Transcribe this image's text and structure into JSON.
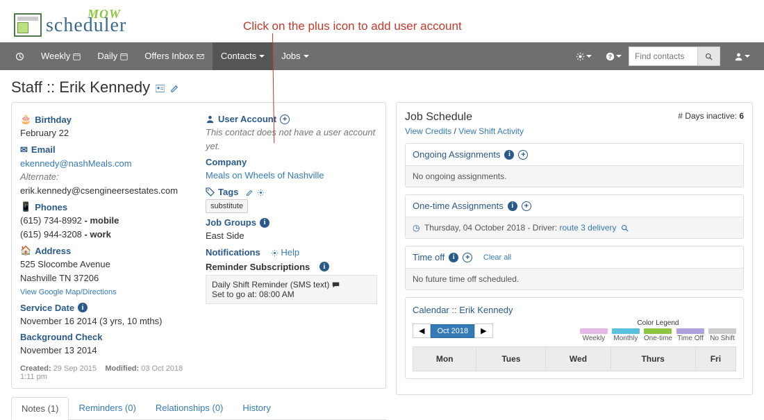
{
  "annotation": "Click on the plus icon to add user account",
  "nav": {
    "weekly": "Weekly",
    "daily": "Daily",
    "offers": "Offers Inbox",
    "contacts": "Contacts",
    "jobs": "Jobs",
    "search_placeholder": "Find contacts"
  },
  "page_title": "Staff :: Erik Kennedy",
  "contact": {
    "birthday_label": "Birthday",
    "birthday_value": "February 22",
    "email_label": "Email",
    "email_primary": "ekennedy@nashMeals.com",
    "email_alt_label": "Alternate:",
    "email_alt": "erik.kennedy@csengineersestates.com",
    "phones_label": "Phones",
    "phone1_num": "(615) 734-8992",
    "phone1_type": " - mobile",
    "phone2_num": "(615) 944-3208",
    "phone2_type": " - work",
    "address_label": "Address",
    "address_line1": "525 Slocombe Avenue",
    "address_line2": "Nashville TN 37206",
    "map_link": "View Google Map/Directions",
    "service_label": "Service Date",
    "service_value": "November 16 2014 (3 yrs, 10 mths)",
    "bg_label": "Background Check",
    "bg_value": "November 13 2014",
    "created_label": "Created:",
    "created_value": "29 Sep 2015",
    "modified_label": "Modified:",
    "modified_value": "03 Oct 2018 1:11 pm"
  },
  "account": {
    "ua_label": "User Account",
    "ua_msg": "This contact does not have a user account yet.",
    "company_label": "Company",
    "company_value": "Meals on Wheels of Nashville",
    "tags_label": "Tags",
    "tag1": "substitute",
    "jg_label": "Job Groups",
    "jg_value": "East Side",
    "notif_label": "Notifications",
    "notif_help": "Help",
    "rs_label": "Reminder Subscriptions",
    "rs_line1": "Daily Shift Reminder (SMS text)",
    "rs_line2": "Set to go at: 08:00 AM"
  },
  "tabs": {
    "notes": "Notes (1)",
    "reminders": "Reminders (0)",
    "relationships": "Relationships (0)",
    "history": "History"
  },
  "schedule": {
    "heading": "Job Schedule",
    "view_credits": "View Credits",
    "sep": " / ",
    "view_shift": "View Shift Activity",
    "days_inactive_label": "# Days inactive: ",
    "days_inactive_value": "6",
    "ongoing_label": "Ongoing Assignments",
    "ongoing_body": "No ongoing assignments.",
    "onetime_label": "One-time Assignments",
    "onetime_date": "Thursday, 04 October 2018 -  Driver:  ",
    "onetime_route": "route 3 delivery",
    "timeoff_label": "Time off",
    "clear_all": "Clear all",
    "timeoff_body": "No future time off scheduled.",
    "cal_label": "Calendar :: Erik Kennedy",
    "cal_month": "Oct 2018",
    "legend_title": "Color Legend",
    "legend": {
      "weekly": "Weekly",
      "monthly": "Monthly",
      "onetime": "One-time",
      "timeoff": "Time Off",
      "noshift": "No Shift"
    },
    "days": {
      "mon": "Mon",
      "tue": "Tues",
      "wed": "Wed",
      "thu": "Thurs",
      "fri": "Fri"
    }
  }
}
